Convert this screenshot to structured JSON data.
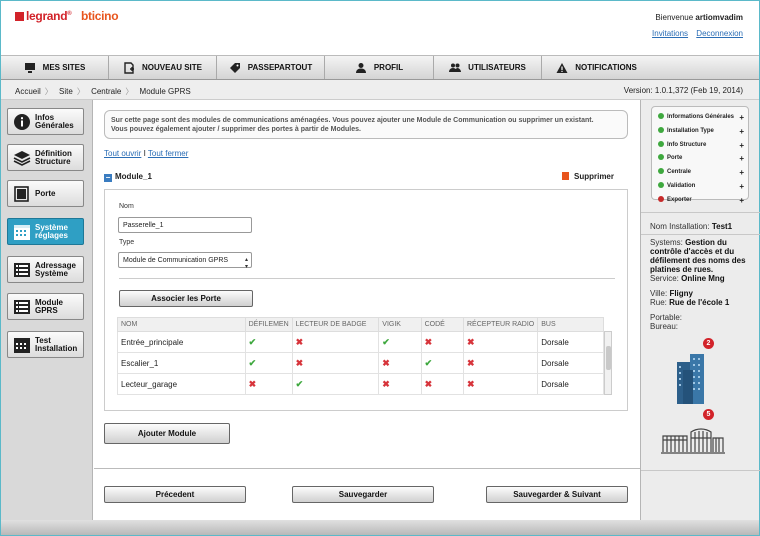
{
  "brand": {
    "legrand": "legrand",
    "legrand_mark": "®",
    "bticino": "bticino"
  },
  "user": {
    "welcome": "Bienvenue",
    "name": "artiomvadim",
    "invitations": "Invitations",
    "logout": "Deconnexion"
  },
  "nav": {
    "items": [
      {
        "label": "MES SITES",
        "icon": "monitor-icon"
      },
      {
        "label": "NOUVEAU SITE",
        "icon": "new-document-icon"
      },
      {
        "label": "PASSEPARTOUT",
        "icon": "tag-icon"
      },
      {
        "label": "PROFIL",
        "icon": "person-icon"
      },
      {
        "label": "UTILISATEURS",
        "icon": "users-icon"
      },
      {
        "label": "NOTIFICATIONS",
        "icon": "warning-icon"
      }
    ]
  },
  "breadcrumb": [
    "Accueil",
    "Site",
    "Centrale",
    "Module GPRS"
  ],
  "version": "Version: 1.0.1,372 (Feb 19, 2014)",
  "sidebar": {
    "items": [
      {
        "label1": "Infos",
        "label2": "Générales",
        "icon": "info-icon",
        "active": false
      },
      {
        "label1": "Définition",
        "label2": "Structure",
        "icon": "layers-icon",
        "active": false
      },
      {
        "label1": "Porte",
        "label2": "",
        "icon": "door-icon",
        "active": false
      },
      {
        "label1": "Système",
        "label2": "réglages",
        "icon": "calendar-icon",
        "active": true
      },
      {
        "label1": "Adressage",
        "label2": "Système",
        "icon": "list-icon",
        "active": false
      },
      {
        "label1": "Module",
        "label2": "GPRS",
        "icon": "list-icon",
        "active": false
      },
      {
        "label1": "Test",
        "label2": "Installation",
        "icon": "calendar-icon",
        "active": false
      }
    ]
  },
  "main": {
    "info_line1": "Sur cette page sont des modules de communications aménagées. Vous pouvez ajouter une Module de Communication ou supprimer un existant.",
    "info_line2": "Vous pouvez également ajouter / supprimer des portes à partir de Modules.",
    "open_all": "Tout ouvrir",
    "close_all": "Tout fermer",
    "toggle_sep": "I",
    "module_title": "Module_1",
    "delete_label": "Supprimer",
    "name_label": "Nom",
    "name_value": "Passerelle_1",
    "type_label": "Type",
    "type_value": "Module de Communication GPRS",
    "associate_button": "Associer les Porte",
    "table": {
      "headers": [
        "NOM",
        "DÉFILEMEN",
        "LECTEUR DE BADGE",
        "VIGIK",
        "CODÉ",
        "RÉCEPTEUR RADIO",
        "BUS"
      ],
      "rows": [
        {
          "nom": "Entrée_principale",
          "cells": [
            "ok",
            "ko",
            "ok",
            "ko",
            "ko"
          ],
          "bus": "Dorsale"
        },
        {
          "nom": "Escalier_1",
          "cells": [
            "ok",
            "ko",
            "ko",
            "ok",
            "ko"
          ],
          "bus": "Dorsale"
        },
        {
          "nom": "Lecteur_garage",
          "cells": [
            "ko",
            "ok",
            "ko",
            "ko",
            "ko"
          ],
          "bus": "Dorsale"
        }
      ]
    },
    "add_module_button": "Ajouter Module",
    "prev_button": "Précedent",
    "save_button": "Sauvegarder",
    "save_next_button": "Sauvegarder & Suivant"
  },
  "right": {
    "steps": [
      {
        "label": "Informations Générales",
        "status": "green"
      },
      {
        "label": "Installation Type",
        "status": "green"
      },
      {
        "label": "Info Structure",
        "status": "green"
      },
      {
        "label": "Porte",
        "status": "green"
      },
      {
        "label": "Centrale",
        "status": "green"
      },
      {
        "label": "Validation",
        "status": "green"
      },
      {
        "label": "Exporter",
        "status": "red"
      }
    ],
    "install_label": "Nom Installation:",
    "install_value": "Test1",
    "systems_label": "Systems:",
    "systems_value": "Gestion du contrôle d'accès et du défilement des noms des platines de rues.",
    "service_label": "Service:",
    "service_value": "Online Mng",
    "ville_label": "Ville:",
    "ville_value": "Fligny",
    "rue_label": "Rue:",
    "rue_value": "Rue de l'école 1",
    "portable_label": "Portable:",
    "bureau_label": "Bureau:",
    "badge_building": "2",
    "badge_gates": "5"
  }
}
